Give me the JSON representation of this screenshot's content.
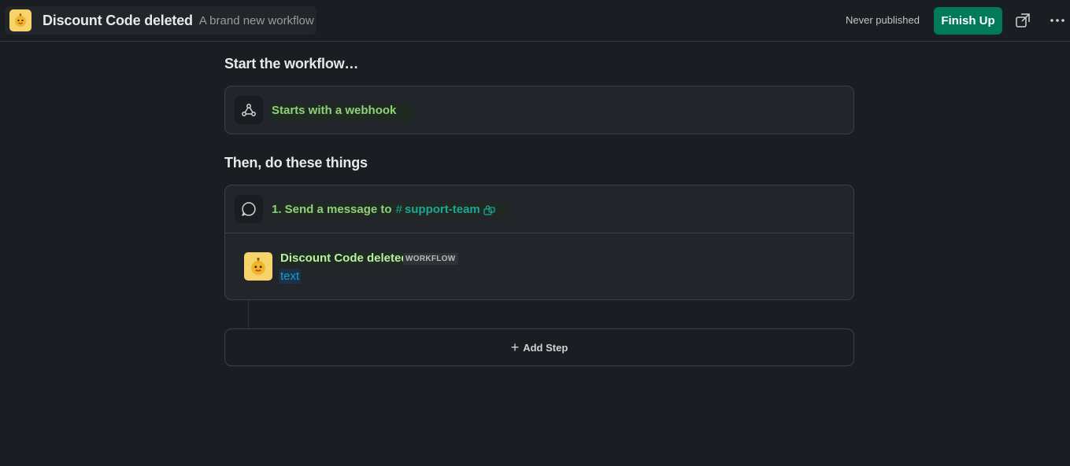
{
  "header": {
    "workflow_title": "Discount Code deleted",
    "workflow_subtitle": "A brand new workflow",
    "publish_status": "Never published",
    "finish_button": "Finish Up",
    "icons": [
      "workflow-bot-icon",
      "open-external-icon",
      "more-options-icon"
    ]
  },
  "trigger_section": {
    "title": "Start the workflow…",
    "trigger_label": "Starts with a webhook",
    "icon": "webhook-icon"
  },
  "steps_section": {
    "title": "Then, do these things",
    "steps": [
      {
        "label": "1. Send a message to",
        "channel_prefix": "#",
        "channel": "support-team",
        "icon": "message-bubble-icon",
        "preview": {
          "sender_name": "Discount Code deleted",
          "sender_badge": "WORKFLOW",
          "message_text": "text"
        }
      }
    ]
  },
  "add_step": {
    "label": "Add Step",
    "plus": "+"
  },
  "colors": {
    "background": "#1a1d21",
    "card": "#222529",
    "accent_green": "#007a5a",
    "variable_green": "#8fd07a",
    "channel_teal": "#1fa39a",
    "link_blue": "#1d9bd1"
  }
}
